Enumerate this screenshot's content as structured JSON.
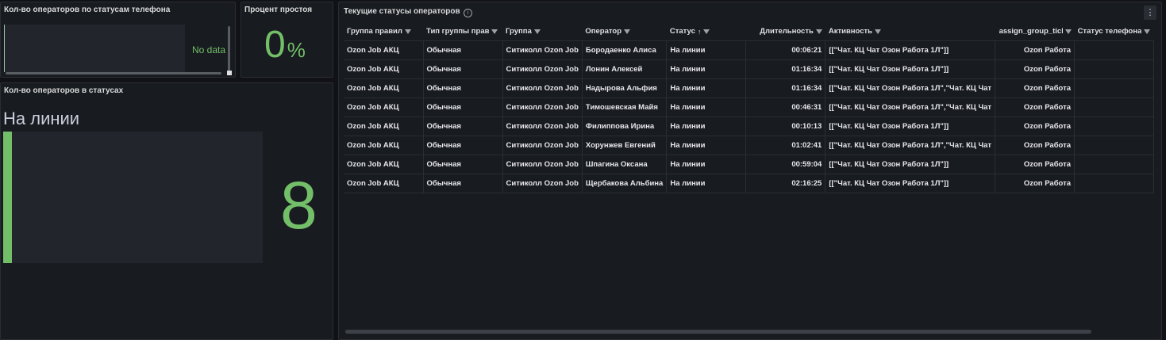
{
  "panels": {
    "phone_status": {
      "title": "Кол-во операторов по статусам телефона",
      "no_data": "No data"
    },
    "idle": {
      "title": "Процент простоя",
      "value": "0",
      "unit": "%"
    },
    "statuses": {
      "title": "Кол-во операторов в статусах",
      "label": "На линии",
      "value": "8",
      "fill_fraction": 1
    },
    "operators": {
      "title": "Текущие статусы операторов",
      "menu_icon": "⋮",
      "info_icon": "i",
      "columns": [
        "Группа правил",
        "Тип группы прав",
        "Группа",
        "Оператор",
        "Статус",
        "Длительность",
        "Активность",
        "assign_group_ticl",
        "Статус телефона"
      ],
      "sort_indicator": "↑",
      "rows": [
        [
          "Ozon Job АКЦ",
          "Обычная",
          "Ситиколл Ozon Job",
          "Бородаенко Алиса",
          "На линии",
          "00:06:21",
          "[[\"Чат. КЦ Чат Озон Работа 1Л\"]]",
          "Ozon Работа",
          ""
        ],
        [
          "Ozon Job АКЦ",
          "Обычная",
          "Ситиколл Ozon Job",
          "Лонин Алексей",
          "На линии",
          "01:16:34",
          "[[\"Чат. КЦ Чат Озон Работа 1Л\"]]",
          "Ozon Работа",
          ""
        ],
        [
          "Ozon Job АКЦ",
          "Обычная",
          "Ситиколл Ozon Job",
          "Надырова Альфия",
          "На линии",
          "01:16:34",
          "[[\"Чат. КЦ Чат Озон Работа 1Л\",\"Чат. КЦ Чат",
          "Ozon Работа",
          ""
        ],
        [
          "Ozon Job АКЦ",
          "Обычная",
          "Ситиколл Ozon Job",
          "Тимошевская Майя",
          "На линии",
          "00:46:31",
          "[[\"Чат. КЦ Чат Озон Работа 1Л\",\"Чат. КЦ Чат",
          "Ozon Работа",
          ""
        ],
        [
          "Ozon Job АКЦ",
          "Обычная",
          "Ситиколл Ozon Job",
          "Филиппова Ирина",
          "На линии",
          "00:10:13",
          "[[\"Чат. КЦ Чат Озон Работа 1Л\"]]",
          "Ozon Работа",
          ""
        ],
        [
          "Ozon Job АКЦ",
          "Обычная",
          "Ситиколл Ozon Job",
          "Хорунжев Евгений",
          "На линии",
          "01:02:41",
          "[[\"Чат. КЦ Чат Озон Работа 1Л\",\"Чат. КЦ Чат",
          "Ozon Работа",
          ""
        ],
        [
          "Ozon Job АКЦ",
          "Обычная",
          "Ситиколл Ozon Job",
          "Шпагина Оксана",
          "На линии",
          "00:59:04",
          "[[\"Чат. КЦ Чат Озон Работа 1Л\"]]",
          "Ozon Работа",
          ""
        ],
        [
          "Ozon Job АКЦ",
          "Обычная",
          "Ситиколл Ozon Job",
          "Щербакова Альбина",
          "На линии",
          "02:16:25",
          "[[\"Чат. КЦ Чат Озон Работа 1Л\"]]",
          "Ozon Работа",
          ""
        ]
      ]
    }
  },
  "colors": {
    "background": "#111217",
    "panel": "#181b1f",
    "accent_green": "#73bf69",
    "text": "#ccccdc"
  }
}
